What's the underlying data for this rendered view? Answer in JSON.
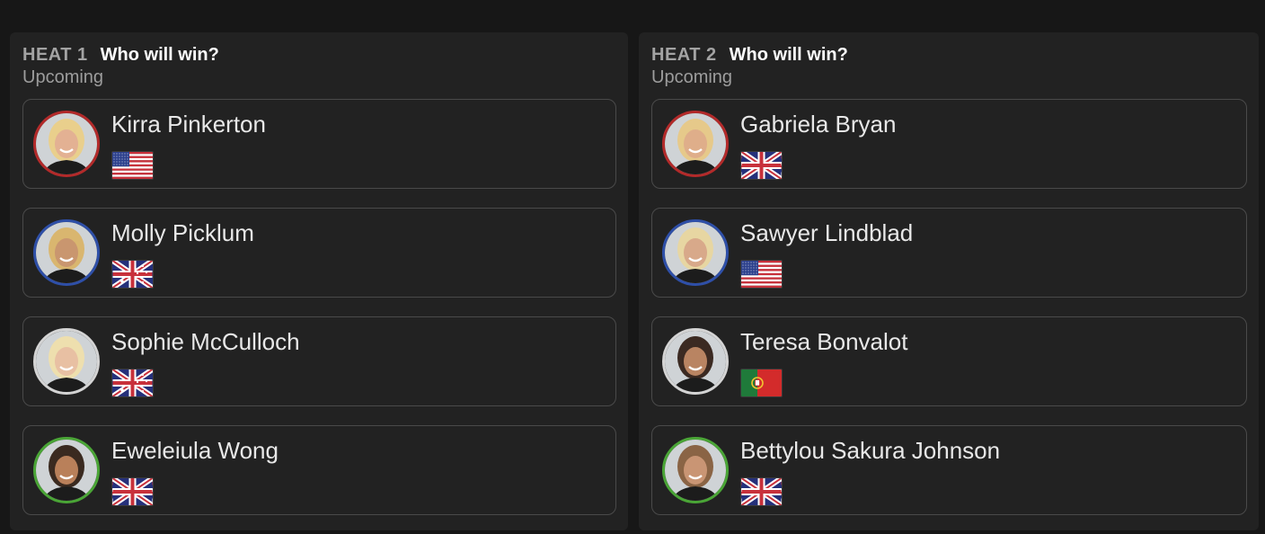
{
  "heats": [
    {
      "label": "HEAT 1",
      "question": "Who will win?",
      "status": "Upcoming",
      "surfers": [
        {
          "name": "Kirra Pinkerton",
          "ring_color": "#b32a2a",
          "flag": "usa-flag",
          "skin": "#e3b193",
          "hair": "#e9cf8c"
        },
        {
          "name": "Molly Picklum",
          "ring_color": "#2e4fa8",
          "flag": "australia-flag",
          "skin": "#c9966f",
          "hair": "#d9b66f"
        },
        {
          "name": "Sophie McCulloch",
          "ring_color": "#d4d4d4",
          "flag": "australia-flag",
          "skin": "#e8c0a3",
          "hair": "#eedfae"
        },
        {
          "name": "Eweleiula Wong",
          "ring_color": "#4aa536",
          "flag": "hawaii-flag",
          "skin": "#b9805a",
          "hair": "#3a2a20"
        }
      ]
    },
    {
      "label": "HEAT 2",
      "question": "Who will win?",
      "status": "Upcoming",
      "surfers": [
        {
          "name": "Gabriela Bryan",
          "ring_color": "#b32a2a",
          "flag": "hawaii-flag",
          "skin": "#dfae8a",
          "hair": "#e6c98a"
        },
        {
          "name": "Sawyer Lindblad",
          "ring_color": "#2e4fa8",
          "flag": "usa-flag",
          "skin": "#d8a98a",
          "hair": "#e7d6a2"
        },
        {
          "name": "Teresa Bonvalot",
          "ring_color": "#d4d4d4",
          "flag": "portugal-flag",
          "skin": "#b98462",
          "hair": "#3b2a22"
        },
        {
          "name": "Bettylou Sakura Johnson",
          "ring_color": "#4aa536",
          "flag": "hawaii-flag",
          "skin": "#c99574",
          "hair": "#8a6445"
        }
      ]
    }
  ]
}
